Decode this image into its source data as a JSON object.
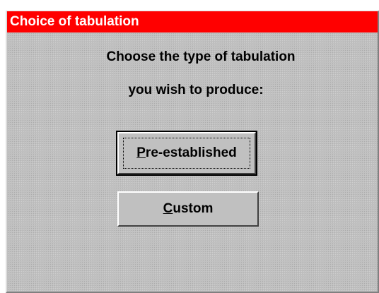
{
  "dialog": {
    "title": "Choice of tabulation",
    "prompt_line1": "Choose the type of tabulation",
    "prompt_line2": "you wish to produce:"
  },
  "buttons": {
    "pre_established": {
      "mnemonic": "P",
      "rest": "re-established",
      "is_default": true
    },
    "custom": {
      "mnemonic": "C",
      "rest": "ustom",
      "is_default": false
    }
  },
  "colors": {
    "title_bar": "#ff0000",
    "title_text": "#ffffff",
    "dialog_face": "#c0c0c0"
  }
}
